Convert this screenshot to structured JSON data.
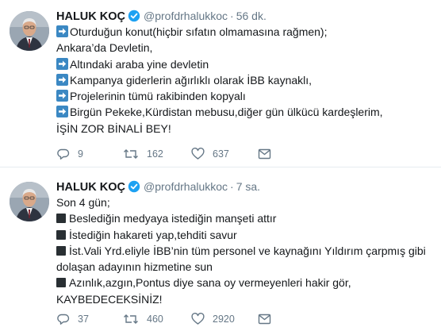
{
  "tweets": [
    {
      "author": {
        "name": "HALUK KOÇ",
        "handle": "@profdrhalukkoc",
        "verified": true
      },
      "time": "56 dk.",
      "lines": [
        {
          "marker": "arrow",
          "text": "Oturduğun konut(hiçbir sıfatın olmamasına rağmen);"
        },
        {
          "marker": "none",
          "text": "Ankara’da Devletin,"
        },
        {
          "marker": "arrow",
          "text": "Altındaki araba yine devletin"
        },
        {
          "marker": "arrow",
          "text": "Kampanya giderlerin ağırlıklı olarak İBB kaynaklı,"
        },
        {
          "marker": "arrow",
          "text": "Projelerinin tümü rakibinden kopyalı"
        },
        {
          "marker": "arrow",
          "text": "Birgün Pekeke,Kürdistan mebusu,diğer gün ülkücü kardeşlerim,"
        },
        {
          "marker": "none",
          "text": "İŞİN ZOR BİNALİ BEY!"
        }
      ],
      "actions": {
        "replies": "9",
        "retweets": "162",
        "likes": "637"
      }
    },
    {
      "author": {
        "name": "HALUK KOÇ",
        "handle": "@profdrhalukkoc",
        "verified": true
      },
      "time": "7 sa.",
      "lines": [
        {
          "marker": "none",
          "text": "Son 4 gün;"
        },
        {
          "marker": "square",
          "text": "Beslediğin medyaya istediğin manşeti attır"
        },
        {
          "marker": "square",
          "text": "İstediğin hakareti yap,tehditi savur"
        },
        {
          "marker": "square",
          "text": "İst.Vali Yrd.eliyle İBB’nin tüm personel ve kaynağını Yıldırım çarpmış gibi"
        },
        {
          "marker": "none",
          "text": "dolaşan adayının hizmetine sun"
        },
        {
          "marker": "square",
          "text": "Azınlık,azgın,Pontus diye sana oy vermeyenleri hakir gör,"
        },
        {
          "marker": "none",
          "text": "KAYBEDECEKSİNİZ!"
        }
      ],
      "actions": {
        "replies": "37",
        "retweets": "460",
        "likes": "2920"
      }
    }
  ],
  "colors": {
    "accent": "#1da1f2",
    "muted": "#657786",
    "text": "#14171a",
    "divider": "#e6ecf0",
    "arrow_emoji": "#3b88c3"
  },
  "icons": [
    "verified-badge-icon",
    "reply-icon",
    "retweet-icon",
    "like-icon",
    "direct-message-icon",
    "right-arrow-emoji-icon",
    "black-square-emoji-icon"
  ]
}
